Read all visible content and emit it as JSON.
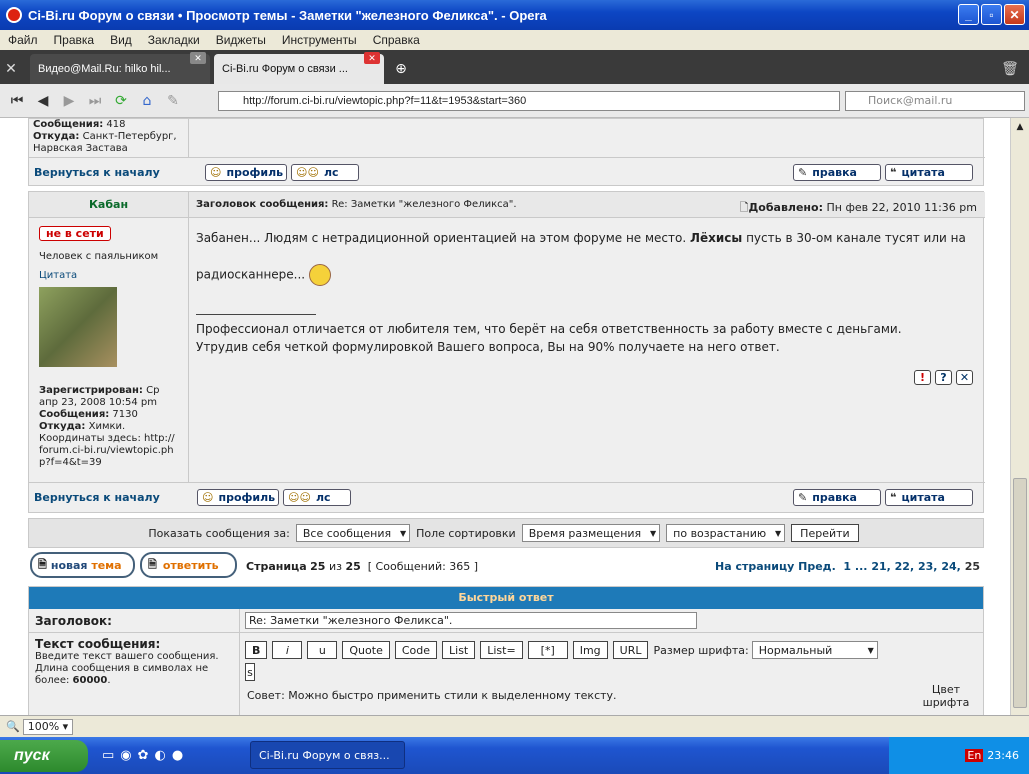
{
  "window": {
    "title": "Ci-Bi.ru Форум о связи • Просмотр темы - Заметки \"железного Феликса\". - Opera"
  },
  "menu": [
    "Файл",
    "Правка",
    "Вид",
    "Закладки",
    "Виджеты",
    "Инструменты",
    "Справка"
  ],
  "tabs": [
    {
      "label": "Видео@Mail.Ru: hilko hil..."
    },
    {
      "label": "Ci-Bi.ru Форум о связи ..."
    }
  ],
  "address": {
    "url": "http://forum.ci-bi.ru/viewtopic.php?f=11&t=1953&start=360",
    "search_placeholder": "Поиск@mail.ru"
  },
  "prev_post": {
    "messages_label": "Сообщения:",
    "messages": "418",
    "from_label": "Откуда:",
    "from": "Санкт-Петербург, Нарвская Застава",
    "back": "Вернуться к началу",
    "profile": "профиль",
    "pm": "лс",
    "edit": "правка",
    "quote": "цитата"
  },
  "post": {
    "author": "Кабан",
    "subject_label": "Заголовок сообщения:",
    "subject": "Re: Заметки \"железного Феликса\".",
    "added_label": "Добавлено:",
    "added": "Пн фев 22, 2010 11:36 pm",
    "status": "не в сети",
    "rank": "Человек с паяльником",
    "quote_link": "Цитата",
    "body_1": "Забанен... Людям с нетрадиционной ориентацией на этом форуме не место.",
    "body_bold": "Лёхисы",
    "body_2": "пусть в 30-ом канале тусят или на",
    "body_3": "радиосканнере...",
    "sig_1": "Профессионал отличается от любителя тем, что берёт на себя ответственность за работу вместе с деньгами.",
    "sig_2": "Утрудив себя четкой формулировкой Вашего вопроса, Вы на 90% получаете на него ответ.",
    "registered_label": "Зарегистрирован:",
    "registered": "Ср апр 23, 2008 10:54 pm",
    "messages_label": "Сообщения:",
    "messages": "7130",
    "from_label": "Откуда:",
    "from": "Химки.",
    "coords": "Координаты здесь: http://forum.ci-bi.ru/viewtopic.php?f=4&t=39",
    "back": "Вернуться к началу",
    "profile": "профиль",
    "pm": "лс",
    "edit": "правка",
    "quote": "цитата"
  },
  "sortbar": {
    "show_label": "Показать сообщения за:",
    "show_value": "Все сообщения",
    "sort_label": "Поле сортировки",
    "sort_value": "Время размещения",
    "order_value": "по возрастанию",
    "go": "Перейти"
  },
  "pagination": {
    "new_topic_1": "новая",
    "new_topic_2": "тема",
    "reply": "ответить",
    "page_label": "Страница",
    "page": "25",
    "of": "из",
    "total": "25",
    "messages": "[ Сообщений: 365 ]",
    "goto_label": "На страницу",
    "prev": "Пред.",
    "pages": [
      "1",
      "...",
      "21,",
      "22,",
      "23,",
      "24,",
      "25"
    ]
  },
  "quick_reply": {
    "header": "Быстрый ответ",
    "subject_label": "Заголовок:",
    "subject_value": "Re: Заметки \"железного Феликса\".",
    "text_label": "Текст сообщения:",
    "text_hint": "Введите текст вашего сообщения. Длина сообщения в символах не более:",
    "max_len": "60000",
    "buttons": [
      "B",
      "i",
      "u",
      "Quote",
      "Code",
      "List",
      "List=",
      "[*]",
      "Img",
      "URL"
    ],
    "fontsize_label": "Размер шрифта:",
    "fontsize_value": "Нормальный",
    "s_btn": "s",
    "tip": "Совет: Можно быстро применить стили к выделенному тексту.",
    "font_color": "Цвет шрифта"
  },
  "status": {
    "zoom": "100%"
  },
  "taskbar": {
    "start": "пуск",
    "task": "Ci-Bi.ru Форум о связ...",
    "lang": "En",
    "time": "23:46"
  },
  "colors": {
    "link": "#0a4a7a",
    "author": "#0a6a2a",
    "qr_header": "#1e7ab8",
    "offline": "#c00000"
  }
}
